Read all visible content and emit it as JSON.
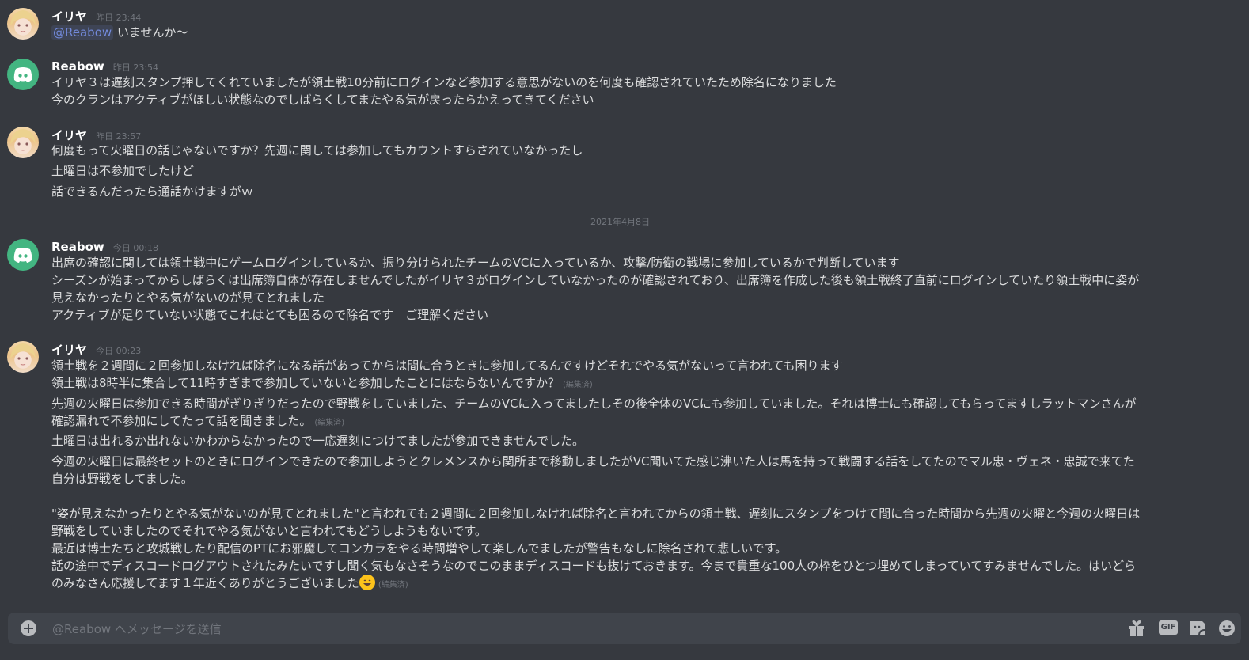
{
  "date_divider": "2021年4月8日",
  "messages": [
    {
      "username": "イリヤ",
      "timestamp": "昨日 23:44",
      "mention": "@Reabow",
      "lines": [
        "いませんか～"
      ]
    },
    {
      "username": "Reabow",
      "timestamp": "昨日 23:54",
      "lines": [
        "イリヤ３は遅刻スタンプ押してくれていましたが領土戦10分前にログインなど参加する意思がないのを何度も確認されていたため除名になりました",
        "今のクランはアクティブがほしい状態なのでしばらくしてまたやる気が戻ったらかえってきてください"
      ]
    },
    {
      "username": "イリヤ",
      "timestamp": "昨日 23:57",
      "lines": [
        "何度もって火曜日の話じゃないですか？先週に関しては参加してもカウントすらされていなかったし",
        "土曜日は不参加でしたけど",
        "話できるんだったら通話かけますがｗ"
      ]
    },
    {
      "username": "Reabow",
      "timestamp": "今日 00:18",
      "lines": [
        "出席の確認に関しては領土戦中にゲームログインしているか、振り分けられたチームのVCに入っているか、攻撃/防衛の戦場に参加しているかで判断しています",
        "シーズンが始まってからしばらくは出席簿自体が存在しませんでしたがイリヤ３がログインしていなかったのが確認されており、出席簿を作成した後も領土戦終了直前にログインしていたり領土戦中に姿が",
        "見えなかったりとやる気がないのが見てとれました",
        "アクティブが足りていない状態でこれはとても困るので除名です　ご理解ください"
      ]
    },
    {
      "username": "イリヤ",
      "timestamp": "今日 00:23",
      "edited": "(編集済)",
      "lines": [
        "領土戦を２週間に２回参加しなければ除名になる話があってからは間に合うときに参加してるんですけどそれでやる気がないって言われても困ります",
        "領土戦は8時半に集合して11時すぎまで参加していないと参加したことにはならないんですか？",
        "先週の火曜日は参加できる時間がぎりぎりだったので野戦をしていました、チームのVCに入ってましたしその後全体のVCにも参加していました。それは博士にも確認してもらってますしラットマンさんが",
        "確認漏れで不参加にしてたって話を聞きました。",
        "土曜日は出れるか出れないかわからなかったので一応遅刻につけてましたが参加できませんでした。",
        "今週の火曜日は最終セットのときにログインできたので参加しようとクレメンスから関所まで移動しましたがVC聞いてた感じ沸いた人は馬を持って戦闘する話をしてたのでマル忠・ヴェネ・忠誠で来てた",
        "自分は野戦をしてました。",
        "\"姿が見えなかったりとやる気がないのが見てとれました\"と言われても２週間に２回参加しなければ除名と言われてからの領土戦、遅刻にスタンプをつけて間に合った時間から先週の火曜と今週の火曜日は",
        "野戦をしていましたのでそれでやる気がないと言われてもどうしようもないです。",
        "最近は博士たちと攻城戦したり配信のPTにお邪魔してコンカラをやる時間増やして楽しんでましたが警告もなしに除名されて悲しいです。",
        "話の途中でディスコードログアウトされたみたいですし聞く気もなさそうなのでこのままディスコードも抜けておきます。今まで貴重な100人の枠をひとつ埋めてしまっていてすみませんでした。はいどら",
        "のみなさん応援してます１年近くありがとうございました"
      ]
    }
  ],
  "composer": {
    "placeholder": "@Reabow へメッセージを送信",
    "gif_label": "GIF"
  },
  "icons": {
    "add": "plus-circle-icon",
    "gift": "gift-icon",
    "gif": "gif-icon",
    "sticker": "sticker-icon",
    "emoji": "emoji-icon"
  },
  "colors": {
    "background": "#36393f",
    "text": "#dcddde",
    "username": "#ffffff",
    "timestamp": "#72767d",
    "mention": "#7289da",
    "discord_avatar": "#43b581",
    "composer": "#40444b"
  }
}
